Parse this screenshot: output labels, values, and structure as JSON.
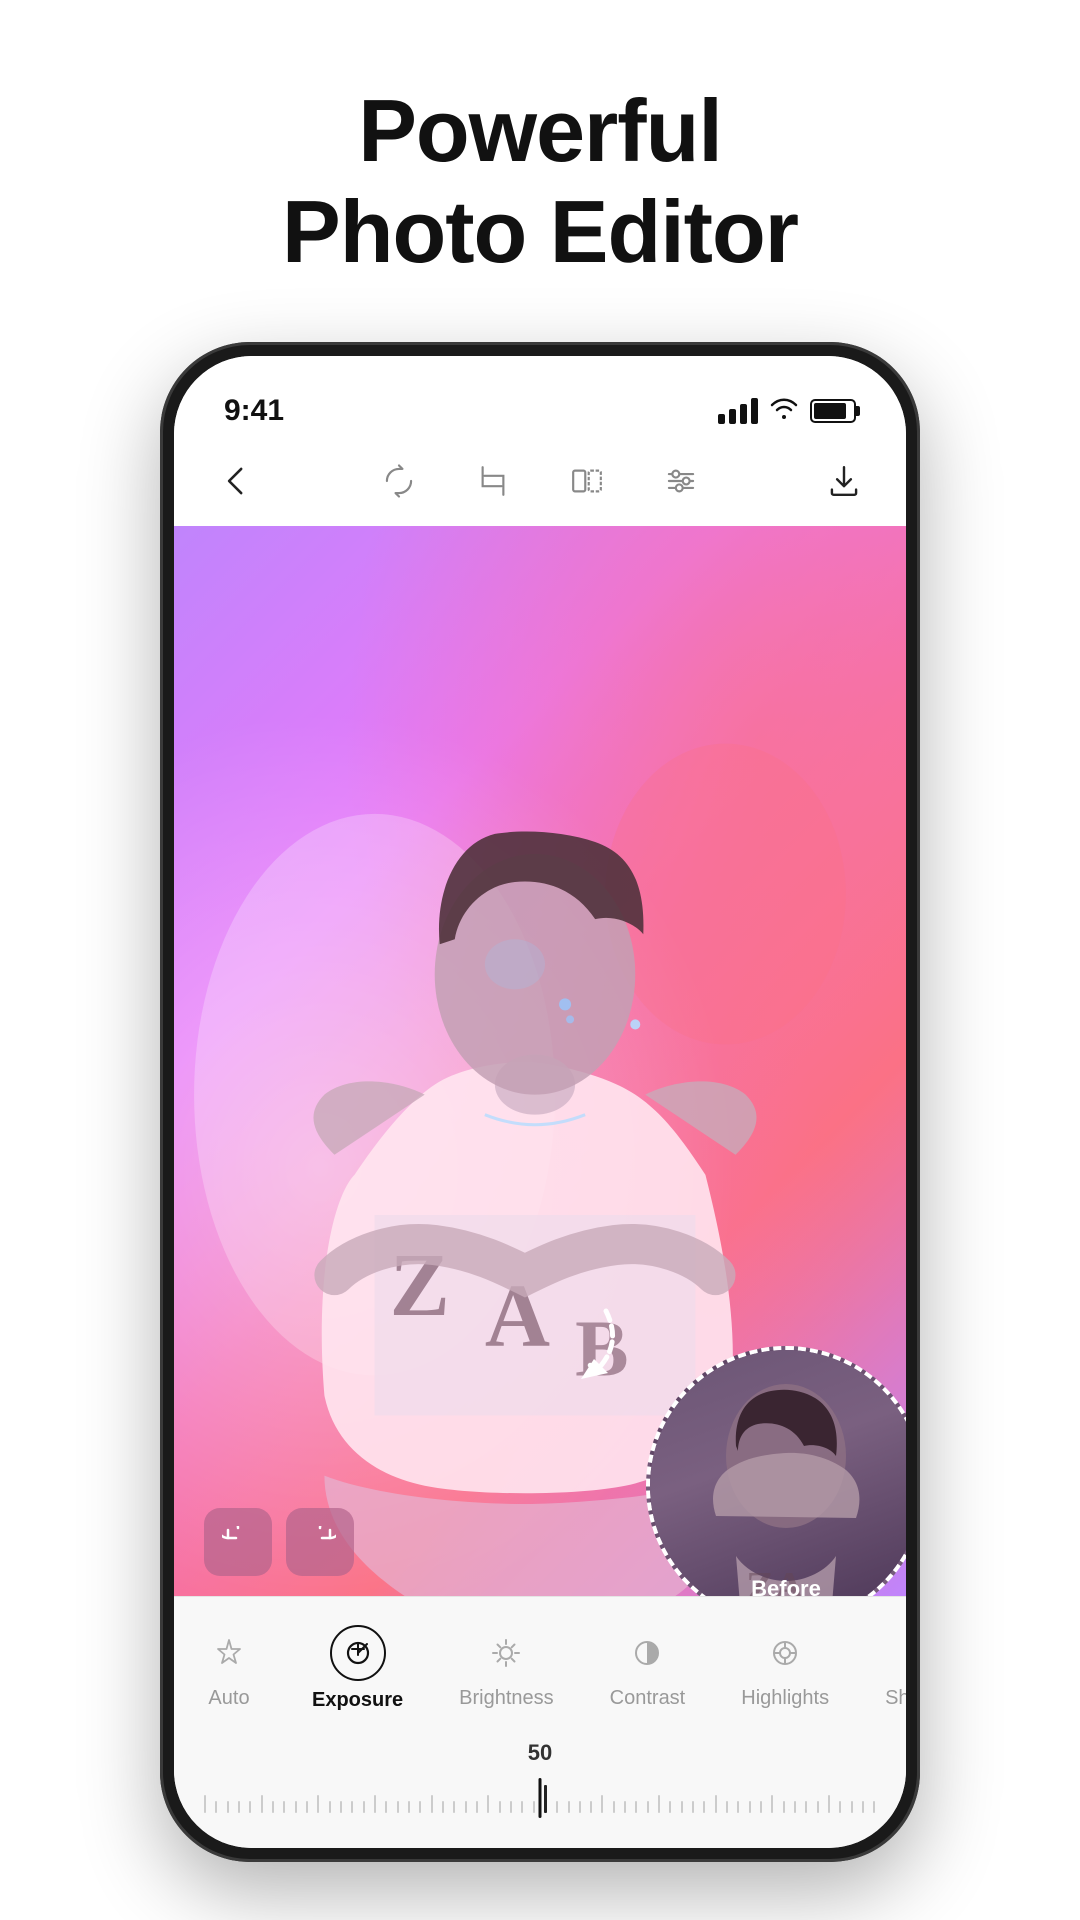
{
  "headline": {
    "line1": "Powerful",
    "line2": "Photo Editor"
  },
  "status_bar": {
    "time": "9:41"
  },
  "toolbar": {
    "back_label": "‹",
    "icons": [
      "rotate",
      "crop",
      "flip",
      "adjust",
      "download"
    ]
  },
  "undo_redo": {
    "undo_label": "↩",
    "redo_label": "↪"
  },
  "before_label": "Before",
  "bottom_panel": {
    "tools": [
      {
        "id": "auto",
        "label": "Auto",
        "icon": "✦",
        "active": false
      },
      {
        "id": "exposure",
        "label": "Exposure",
        "icon": "⊕",
        "active": true
      },
      {
        "id": "brightness",
        "label": "Brightness",
        "icon": "☀",
        "active": false
      },
      {
        "id": "contrast",
        "label": "Contrast",
        "icon": "◐",
        "active": false
      },
      {
        "id": "highlights",
        "label": "Highlights",
        "icon": "◈",
        "active": false
      },
      {
        "id": "shadows",
        "label": "Shadows",
        "icon": "◉",
        "active": false
      }
    ],
    "slider_value": "50"
  }
}
